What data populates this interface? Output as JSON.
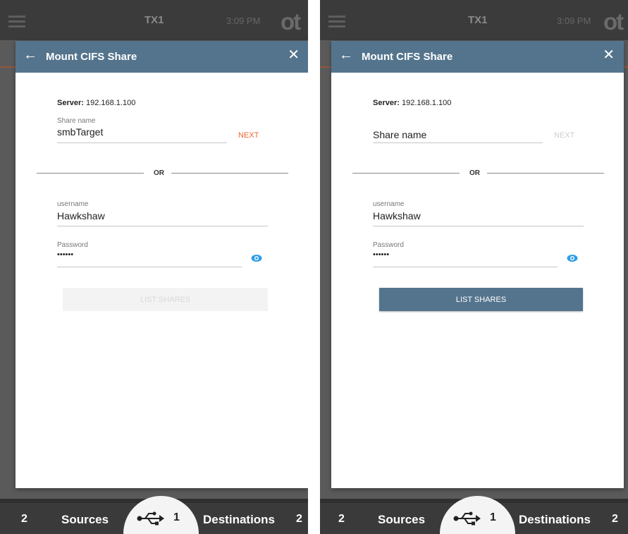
{
  "panels": [
    {
      "topbar": {
        "device": "TX1",
        "time": "3:09 PM",
        "logo": "ot"
      },
      "dialog": {
        "title": "Mount CIFS Share",
        "server_label": "Server:",
        "server_value": "192.168.1.100",
        "share_label": "Share name",
        "share_value": "smbTarget",
        "next_label": "NEXT",
        "next_color": "#f0672e",
        "or_label": "OR",
        "username_label": "username",
        "username_value": "Hawkshaw",
        "password_label": "Password",
        "password_value": "••••••",
        "list_button": "LIST SHARES",
        "list_button_state": "disabled"
      },
      "bottombar": {
        "sources_count": "2",
        "sources_label": "Sources",
        "usb_count": "1",
        "destinations_label": "Destinations",
        "destinations_count": "2"
      }
    },
    {
      "topbar": {
        "device": "TX1",
        "time": "3:09 PM",
        "logo": "ot"
      },
      "dialog": {
        "title": "Mount CIFS Share",
        "server_label": "Server:",
        "server_value": "192.168.1.100",
        "share_placeholder": "Share name",
        "next_label": "NEXT",
        "next_color": "#cfcfcf",
        "or_label": "OR",
        "username_label": "username",
        "username_value": "Hawkshaw",
        "password_label": "Password",
        "password_value": "••••••",
        "list_button": "LIST SHARES",
        "list_button_state": "enabled"
      },
      "bottombar": {
        "sources_count": "2",
        "sources_label": "Sources",
        "usb_count": "1",
        "destinations_label": "Destinations",
        "destinations_count": "2"
      }
    }
  ],
  "colors": {
    "header": "#54748d",
    "accent_eye": "#2f9ee8",
    "next_active": "#f0672e"
  },
  "icons": [
    "menu-icon",
    "back-arrow-icon",
    "close-icon",
    "eye-icon",
    "usb-icon"
  ]
}
